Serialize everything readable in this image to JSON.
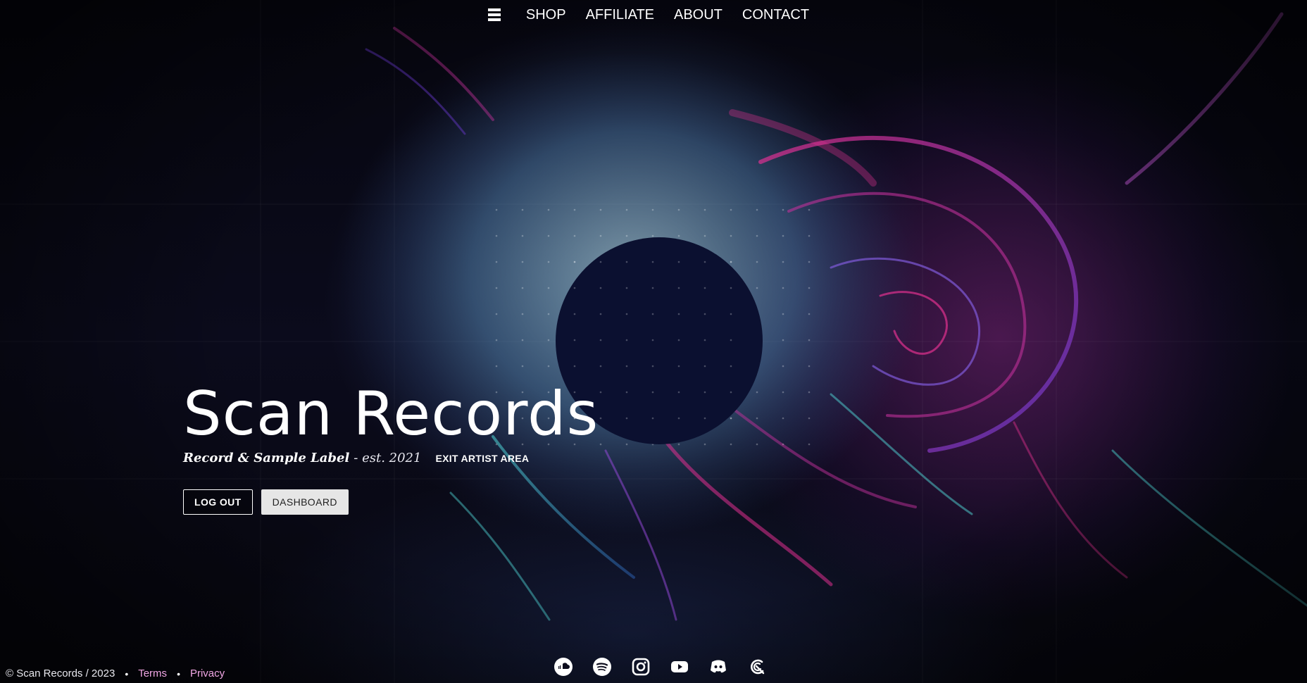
{
  "nav": {
    "menu_icon": "hamburger-menu-icon",
    "items": [
      {
        "label": "SHOP"
      },
      {
        "label": "AFFILIATE"
      },
      {
        "label": "ABOUT"
      },
      {
        "label": "CONTACT"
      }
    ]
  },
  "hero": {
    "title": "Scan Records",
    "tagline": "Record & Sample Label",
    "established": "- est. 2021",
    "exit_link": "EXIT ARTIST AREA",
    "buttons": {
      "logout": "LOG OUT",
      "dashboard": "DASHBOARD"
    }
  },
  "footer": {
    "copyright": "© Scan Records / 2023",
    "separator": "•",
    "terms": "Terms",
    "privacy": "Privacy"
  },
  "socials": [
    {
      "icon": "soundcloud-icon"
    },
    {
      "icon": "spotify-icon"
    },
    {
      "icon": "instagram-icon"
    },
    {
      "icon": "youtube-icon"
    },
    {
      "icon": "discord-icon"
    },
    {
      "icon": "beatport-icon"
    }
  ],
  "colors": {
    "background": "#0a0a17",
    "accent_pink": "#e0308f",
    "accent_cyan": "#4fd6d6",
    "footer_link": "#f0a6e4",
    "button_fill": "#e6e6e6"
  }
}
